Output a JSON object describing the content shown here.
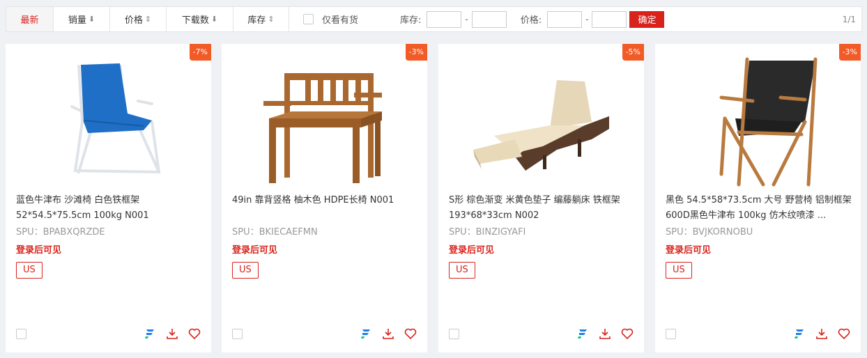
{
  "toolbar": {
    "sorts": [
      {
        "label": "最新",
        "arrow": ""
      },
      {
        "label": "销量",
        "arrow": "⬇"
      },
      {
        "label": "价格",
        "arrow": "⇕"
      },
      {
        "label": "下载数",
        "arrow": "⬇"
      },
      {
        "label": "库存",
        "arrow": "⇕"
      }
    ],
    "in_stock_label": "仅看有货",
    "stock_label": "库存:",
    "price_label": "价格:",
    "dash": "-",
    "confirm_label": "确定",
    "pager": "1/1"
  },
  "colors": {
    "accent": "#d9221b",
    "discount": "#f25a26",
    "brand_icon": "#1f7ee8"
  },
  "products": [
    {
      "discount": "-7%",
      "title": "蓝色牛津布 沙滩椅 白色铁框架 52*54.5*75.5cm 100kg N001",
      "spu": "SPU：BPABXQRZDE",
      "login": "登录后可见",
      "tag": "US",
      "image": "blue-beach-chair"
    },
    {
      "discount": "-3%",
      "title": "49in 靠背竖格 柚木色 HDPE长椅 N001",
      "spu": "SPU：BKIECAEFMN",
      "login": "登录后可见",
      "tag": "US",
      "image": "teak-bench"
    },
    {
      "discount": "-5%",
      "title": "S形 棕色渐变 米黄色垫子 编藤躺床 铁框架 193*68*33cm N002",
      "spu": "SPU：BINZIGYAFI",
      "login": "登录后可见",
      "tag": "US",
      "image": "rattan-lounger"
    },
    {
      "discount": "-3%",
      "title": "黑色 54.5*58*73.5cm 大号 野营椅 铝制框架 600D黑色牛津布 100kg 仿木纹喷漆 ...",
      "spu": "SPU：BVJKORNOBU",
      "login": "登录后可见",
      "tag": "US",
      "image": "camping-chair"
    }
  ]
}
